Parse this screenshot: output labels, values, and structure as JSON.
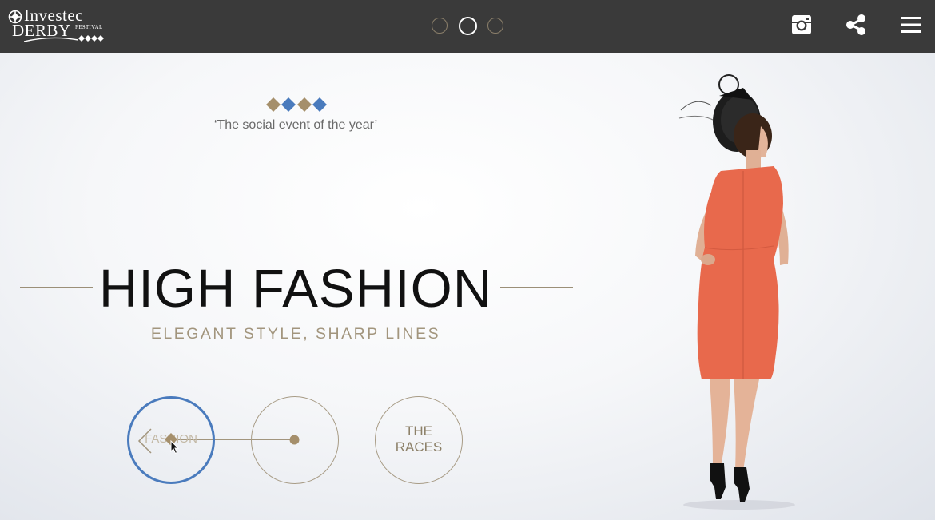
{
  "header": {
    "logo": {
      "line1": "Investec",
      "line2": "DERBY",
      "line3": "FESTIVAL"
    },
    "pager": [
      {
        "active": false
      },
      {
        "active": true
      },
      {
        "active": false
      }
    ],
    "icons": [
      "instagram-icon",
      "share-icon",
      "menu-icon"
    ]
  },
  "hero": {
    "diamond_colors": [
      "#a58f6b",
      "#4a7bbd",
      "#a58f6b",
      "#4a7bbd"
    ],
    "quote": "‘The social event of the year’",
    "title": "HIGH FASHION",
    "subtitle": "ELEGANT STYLE, SHARP LINES"
  },
  "nav": {
    "fashion_label": "FASHION",
    "races_label_line1": "THE",
    "races_label_line2": "RACES"
  },
  "colors": {
    "topbar": "#3a3a3a",
    "gold": "#a2957d",
    "blue": "#4a7bbd",
    "dress": "#e8694c"
  }
}
